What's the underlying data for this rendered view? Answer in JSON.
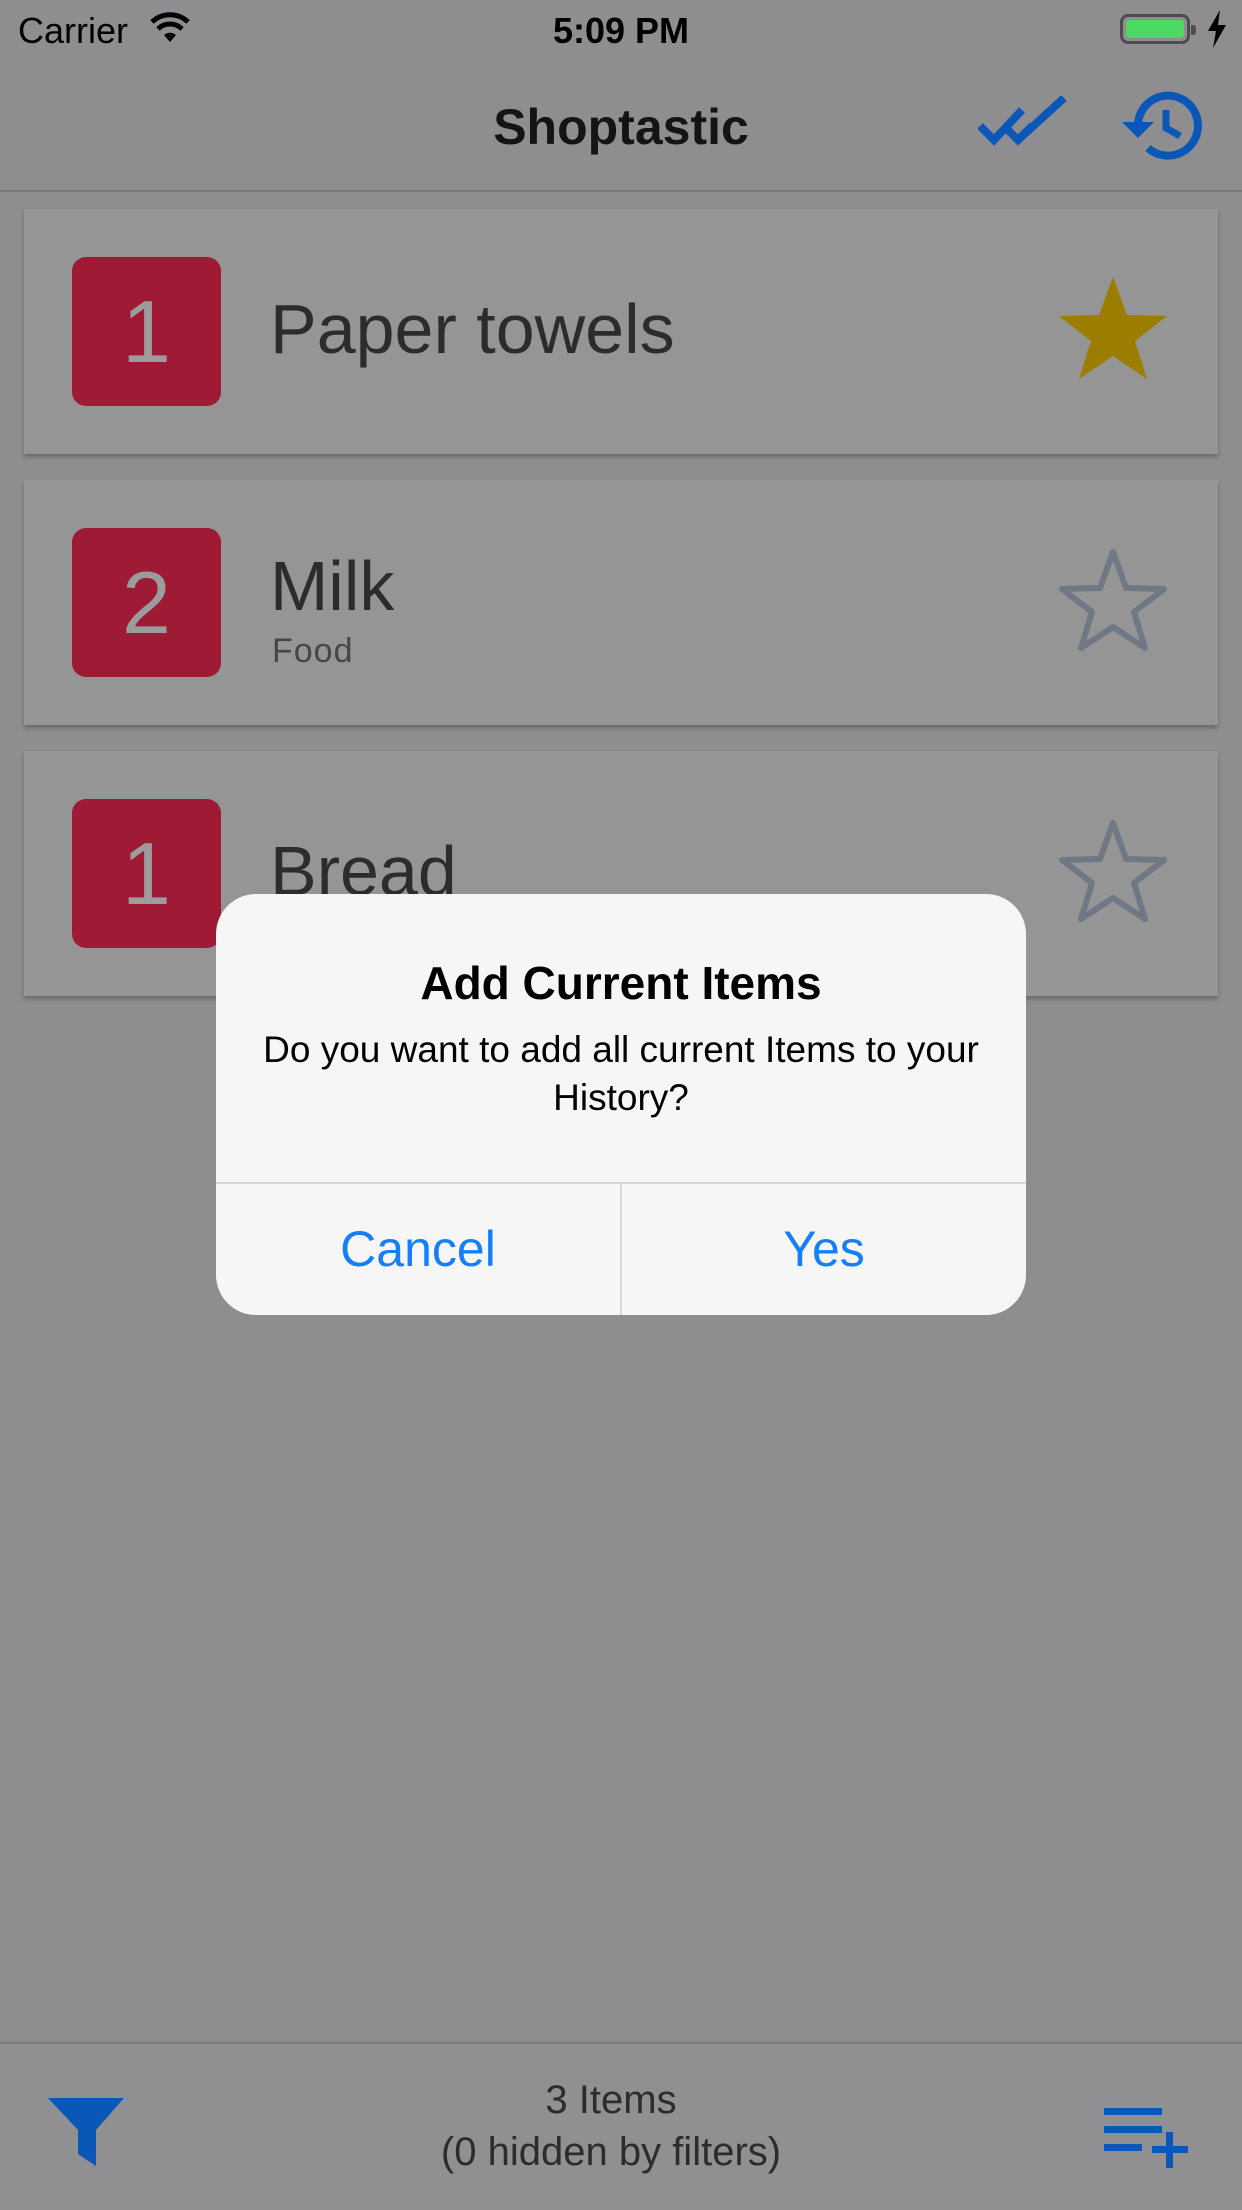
{
  "status_bar": {
    "carrier": "Carrier",
    "time": "5:09 PM",
    "wifi_icon": "wifi-icon",
    "battery_icon": "battery-icon",
    "charging_icon": "bolt-icon"
  },
  "nav": {
    "title": "Shoptastic",
    "check_icon": "double-check-icon",
    "history_icon": "history-icon",
    "accent": "#0b57b8"
  },
  "items": [
    {
      "quantity": "1",
      "name": "Paper towels",
      "category": "",
      "favorite": true
    },
    {
      "quantity": "2",
      "name": "Milk",
      "category": "Food",
      "favorite": false
    },
    {
      "quantity": "1",
      "name": "Bread",
      "category": "",
      "favorite": false
    }
  ],
  "colors": {
    "quantity_badge": "#9e1a35",
    "star_filled": "#9b7e00",
    "star_outline": "#6f7884",
    "alert_button": "#157efb"
  },
  "alert": {
    "title": "Add Current Items",
    "message": "Do you want to add all current Items to your History?",
    "cancel_label": "Cancel",
    "yes_label": "Yes"
  },
  "footer": {
    "count_label": "3 Items",
    "hidden_label": "(0 hidden by filters)",
    "filter_icon": "filter-icon",
    "add_list_icon": "playlist-add-icon"
  }
}
